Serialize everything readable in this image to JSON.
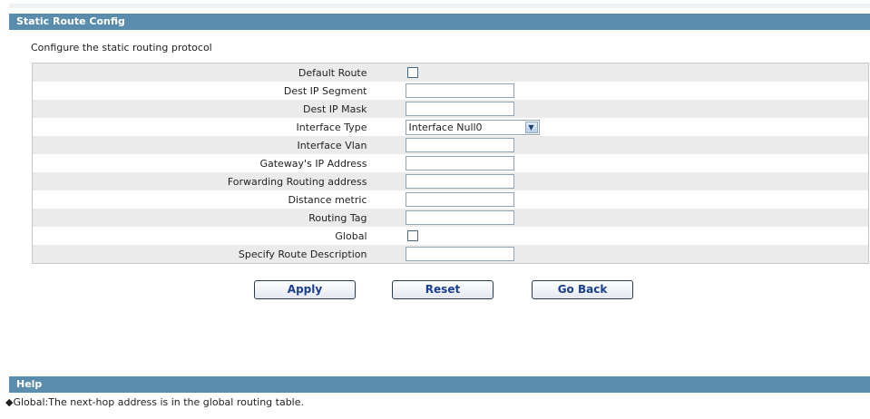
{
  "header": {
    "title": "Static Route Config"
  },
  "subtitle": "Configure the static routing protocol",
  "form": {
    "default_route": {
      "label": "Default Route",
      "checked": false
    },
    "dest_ip_segment": {
      "label": "Dest IP Segment",
      "value": ""
    },
    "dest_ip_mask": {
      "label": "Dest IP Mask",
      "value": ""
    },
    "interface_type": {
      "label": "Interface Type",
      "selected": "Interface Null0"
    },
    "interface_vlan": {
      "label": "Interface Vlan",
      "value": ""
    },
    "gateway_ip": {
      "label": "Gateway's IP Address",
      "value": ""
    },
    "forwarding_address": {
      "label": "Forwarding Routing address",
      "value": ""
    },
    "distance_metric": {
      "label": "Distance metric",
      "value": ""
    },
    "routing_tag": {
      "label": "Routing Tag",
      "value": ""
    },
    "global": {
      "label": "Global",
      "checked": false
    },
    "route_description": {
      "label": "Specify Route Description",
      "value": ""
    }
  },
  "buttons": {
    "apply": "Apply",
    "reset": "Reset",
    "go_back": "Go Back"
  },
  "help": {
    "title": "Help",
    "text": "◆Global:The next-hop address is in the global routing table."
  },
  "icons": {
    "dropdown": "chevron-down-icon"
  },
  "colors": {
    "header_bar": "#5a8cad",
    "button_text": "#1a3f8f",
    "row_alt": "#ebebeb"
  }
}
